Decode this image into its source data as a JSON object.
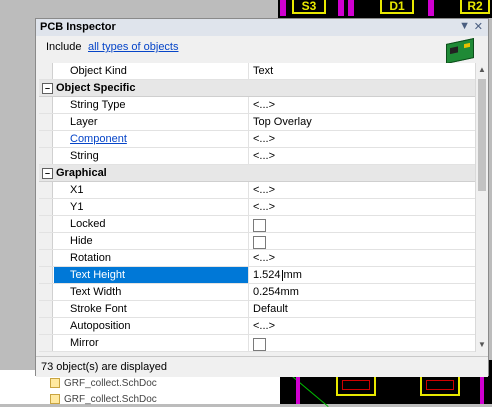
{
  "background": {
    "silk_labels": [
      "S3",
      "D1",
      "R2"
    ],
    "tree_items": [
      "GRF_collect.SchDoc",
      "GRF_collect.SchDoc"
    ]
  },
  "panel": {
    "title": "PCB Inspector",
    "include_label": "Include",
    "include_link": "all types of objects",
    "status_text": "73 object(s) are displayed"
  },
  "rows": {
    "object_kind": {
      "name": "Object Kind",
      "value": "Text"
    },
    "cat_specific": {
      "expander": "–",
      "title": "Object Specific"
    },
    "string_type": {
      "name": "String Type",
      "value": "<...>"
    },
    "layer": {
      "name": "Layer",
      "value": "Top Overlay"
    },
    "component": {
      "name": "Component",
      "value": "<...>"
    },
    "string": {
      "name": "String",
      "value": "<...>"
    },
    "cat_graphical": {
      "expander": "–",
      "title": "Graphical"
    },
    "x1": {
      "name": "X1",
      "value": "<...>"
    },
    "y1": {
      "name": "Y1",
      "value": "<...>"
    },
    "locked": {
      "name": "Locked",
      "checked": false
    },
    "hide": {
      "name": "Hide",
      "checked": false
    },
    "rotation": {
      "name": "Rotation",
      "value": "<...>"
    },
    "text_height": {
      "name": "Text Height",
      "value_a": "1.524",
      "value_b": "mm"
    },
    "text_width": {
      "name": "Text Width",
      "value": "0.254mm"
    },
    "stroke_font": {
      "name": "Stroke Font",
      "value": "Default"
    },
    "autoposition": {
      "name": "Autoposition",
      "value": "<...>"
    },
    "mirror": {
      "name": "Mirror",
      "checked": false
    }
  },
  "icons": [
    "pin-icon",
    "close-icon",
    "pcb-board-icon",
    "scroll-up-icon",
    "scroll-down-icon",
    "collapse-icon"
  ],
  "colors": {
    "selection": "#0078d7",
    "link": "#0645c8",
    "silkscreen": "#e8e800",
    "board_bg": "#000000"
  }
}
